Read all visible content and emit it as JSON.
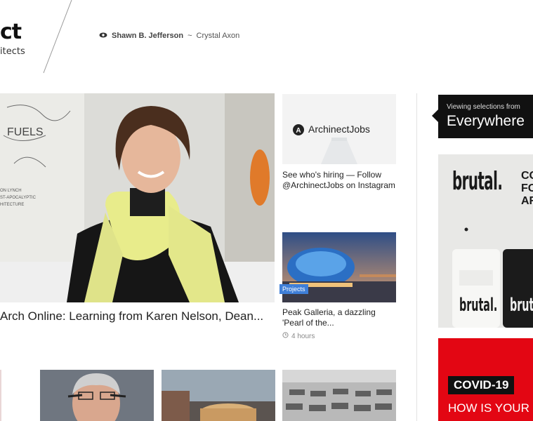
{
  "header": {
    "logo_main": "ct",
    "logo_sub": "itects",
    "user_name": "Shawn B. Jefferson",
    "user_separator": "~",
    "user_org": "Crystal Axon",
    "view_icon": "eye-icon"
  },
  "hero": {
    "title": "Arch Online: Learning from Karen Nelson, Dean..."
  },
  "side_cards": [
    {
      "brand": "ArchinectJobs",
      "text_line1": "See who's hiring — Follow",
      "text_line2": "@ArchinectJobs on Instagram"
    },
    {
      "badge": "Projects",
      "text_line1": "Peak Galleria, a dazzling",
      "text_line2": "'Pearl of the...",
      "time": "4 hours",
      "time_icon": "clock-icon"
    }
  ],
  "right_rail": {
    "viewing_label": "Viewing selections from",
    "viewing_value": "Everywhere",
    "ad1": {
      "logo": "brutal.",
      "letters": [
        "CO",
        "FO",
        "AR"
      ]
    },
    "ad2": {
      "line1": "COVID-19",
      "line2": "HOW IS YOUR"
    }
  },
  "colors": {
    "badge_blue": "#3f7fd8",
    "covid_red": "#e30613",
    "rail_black": "#111111"
  }
}
